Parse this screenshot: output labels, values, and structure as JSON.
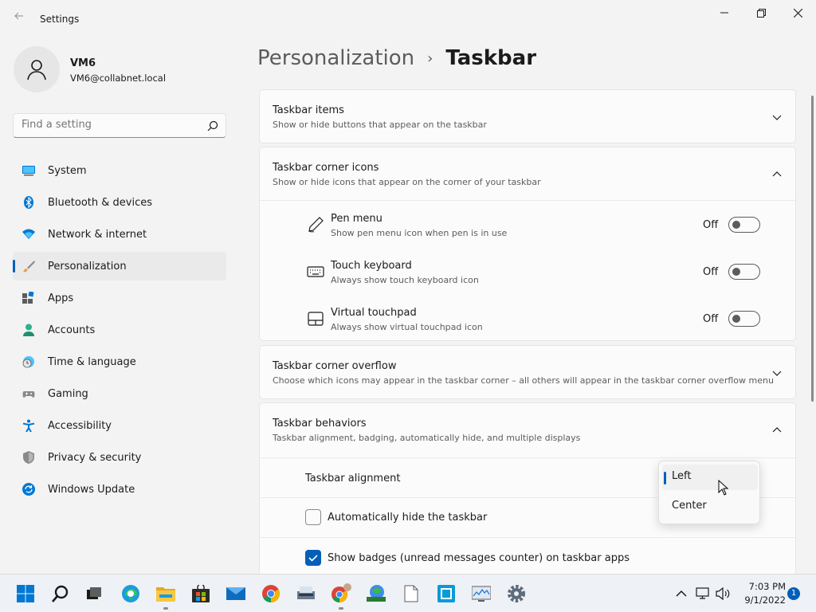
{
  "window": {
    "title": "Settings"
  },
  "user": {
    "name": "VM6",
    "email": "VM6@collabnet.local"
  },
  "search": {
    "placeholder": "Find a setting"
  },
  "nav": {
    "items": [
      {
        "label": "System",
        "icon": "monitor-icon"
      },
      {
        "label": "Bluetooth & devices",
        "icon": "bluetooth-icon"
      },
      {
        "label": "Network & internet",
        "icon": "wifi-icon"
      },
      {
        "label": "Personalization",
        "icon": "brush-icon",
        "active": true
      },
      {
        "label": "Apps",
        "icon": "apps-icon"
      },
      {
        "label": "Accounts",
        "icon": "person-icon"
      },
      {
        "label": "Time & language",
        "icon": "clock-globe-icon"
      },
      {
        "label": "Gaming",
        "icon": "gamepad-icon"
      },
      {
        "label": "Accessibility",
        "icon": "accessibility-icon"
      },
      {
        "label": "Privacy & security",
        "icon": "shield-icon"
      },
      {
        "label": "Windows Update",
        "icon": "update-icon"
      }
    ]
  },
  "breadcrumb": {
    "parent": "Personalization",
    "separator": "›",
    "current": "Taskbar"
  },
  "sections": {
    "taskbar_items": {
      "title": "Taskbar items",
      "desc": "Show or hide buttons that appear on the taskbar"
    },
    "corner_icons": {
      "title": "Taskbar corner icons",
      "desc": "Show or hide icons that appear on the corner of your taskbar",
      "items": [
        {
          "title": "Pen menu",
          "desc": "Show pen menu icon when pen is in use",
          "state": "Off"
        },
        {
          "title": "Touch keyboard",
          "desc": "Always show touch keyboard icon",
          "state": "Off"
        },
        {
          "title": "Virtual touchpad",
          "desc": "Always show virtual touchpad icon",
          "state": "Off"
        }
      ]
    },
    "corner_overflow": {
      "title": "Taskbar corner overflow",
      "desc": "Choose which icons may appear in the taskbar corner – all others will appear in the taskbar corner overflow menu"
    },
    "behaviors": {
      "title": "Taskbar behaviors",
      "desc": "Taskbar alignment, badging, automatically hide, and multiple displays",
      "alignment_label": "Taskbar alignment",
      "alignment_options": [
        "Left",
        "Center"
      ],
      "alignment_selected": "Left",
      "auto_hide_label": "Automatically hide the taskbar",
      "auto_hide_checked": false,
      "badges_label": "Show badges (unread messages counter) on taskbar apps",
      "badges_checked": true
    }
  },
  "taskbar": {
    "apps": [
      "start-icon",
      "search-icon",
      "task-view-icon",
      "edge-icon",
      "file-explorer-icon",
      "store-icon",
      "mail-icon",
      "chrome-icon",
      "scanner-icon",
      "chrome-profile-icon",
      "network-globe-icon",
      "document-icon",
      "store-app-icon",
      "monitor-app-icon",
      "settings-icon"
    ],
    "tray": [
      "chevron-up-icon",
      "network-icon",
      "volume-icon"
    ],
    "time": "7:03 PM",
    "date": "9/1/2022",
    "notifications": "1"
  },
  "colors": {
    "accent": "#005fb8",
    "background": "#f3f3f3",
    "card": "#fbfbfb"
  }
}
